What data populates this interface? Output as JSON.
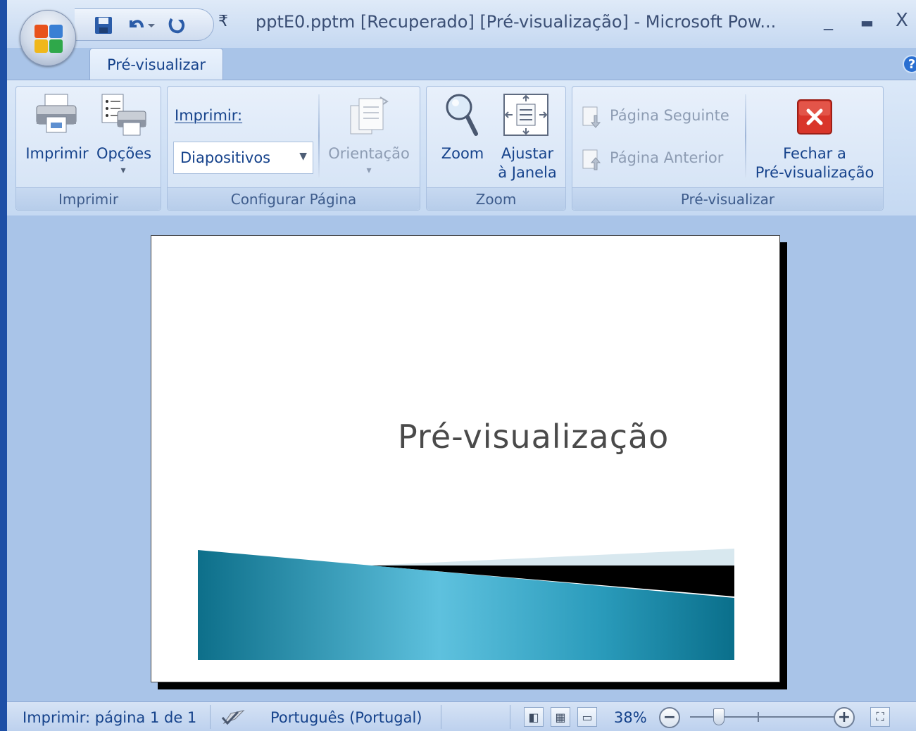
{
  "window": {
    "title": "pptE0.pptm [Recuperado] [Pré-visualização] - Microsoft Pow...",
    "minimize": "_",
    "maximize": "▬",
    "close": "X"
  },
  "quick_access": {
    "icons": [
      "save-icon",
      "undo-icon",
      "redo-icon"
    ],
    "customize": "₹"
  },
  "ribbon": {
    "active_tab": "Pré-visualizar",
    "help": "?",
    "groups": {
      "imprimir": {
        "label": "Imprimir",
        "print_button": "Imprimir",
        "options_button": "Opções",
        "options_arrow": "▾"
      },
      "configurar": {
        "label": "Configurar Página",
        "print_what_label": "Imprimir:",
        "print_what_value": "Diapositivos",
        "orientation_button": "Orientação",
        "orientation_arrow": "▾"
      },
      "zoom": {
        "label": "Zoom",
        "zoom_button": "Zoom",
        "fit_line1": "Ajustar",
        "fit_line2": "à Janela"
      },
      "previsualizar": {
        "label": "Pré-visualizar",
        "next_page": "Página Seguinte",
        "prev_page": "Página Anterior",
        "close_line1": "Fechar a",
        "close_line2": "Pré-visualização"
      }
    }
  },
  "slide": {
    "title": "Pré-visualização"
  },
  "status": {
    "page_info": "Imprimir: página 1 de 1",
    "language": "Português (Portugal)",
    "zoom_level": "38%",
    "zoom_out": "−",
    "zoom_in": "+",
    "zoom_slider_level": 0.16
  },
  "colors": {
    "ribbon_text": "#15428b",
    "close_red": "#d9352a",
    "teal": "#2a9bbb"
  }
}
